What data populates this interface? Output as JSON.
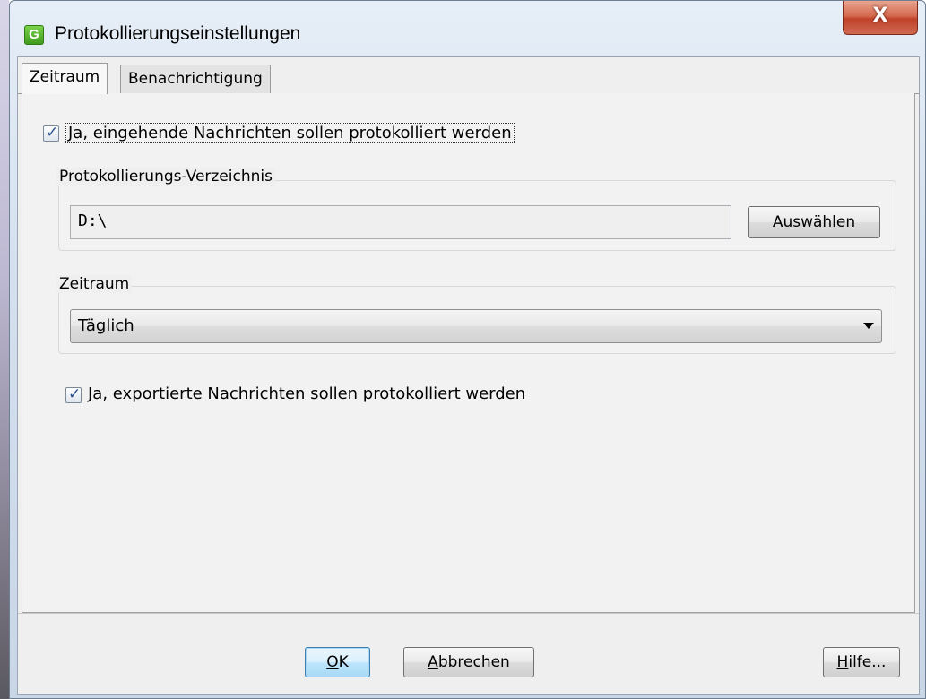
{
  "window": {
    "title": "Protokollierungseinstellungen",
    "app_icon_letter": "G",
    "close_glyph": "X"
  },
  "tabs": [
    {
      "label": "Zeitraum",
      "active": true
    },
    {
      "label": "Benachrichtigung",
      "active": false
    }
  ],
  "log_incoming": {
    "label": "Ja, eingehende Nachrichten sollen protokolliert werden",
    "checked": true
  },
  "directory_group": {
    "title": "Protokollierungs-Verzeichnis",
    "path_value": "D:\\",
    "select_button": "Auswählen"
  },
  "period_group": {
    "title": "Zeitraum",
    "selected_value": "Täglich"
  },
  "log_exported": {
    "label": "Ja, exportierte Nachrichten sollen protokolliert werden",
    "checked": true
  },
  "buttons": {
    "ok_mnemonic": "O",
    "ok_rest": "K",
    "cancel_mnemonic": "A",
    "cancel_rest": "bbrechen",
    "help_mnemonic": "H",
    "help_rest": "ilfe..."
  },
  "icons": {
    "checkbox_check": "✓",
    "app_icon": "app-g-icon",
    "dropdown": "triangle-down-icon"
  },
  "colors": {
    "app_icon_green": "#4caf28",
    "close_red": "#c0422a",
    "default_button_blue": "#3c7fb1"
  }
}
